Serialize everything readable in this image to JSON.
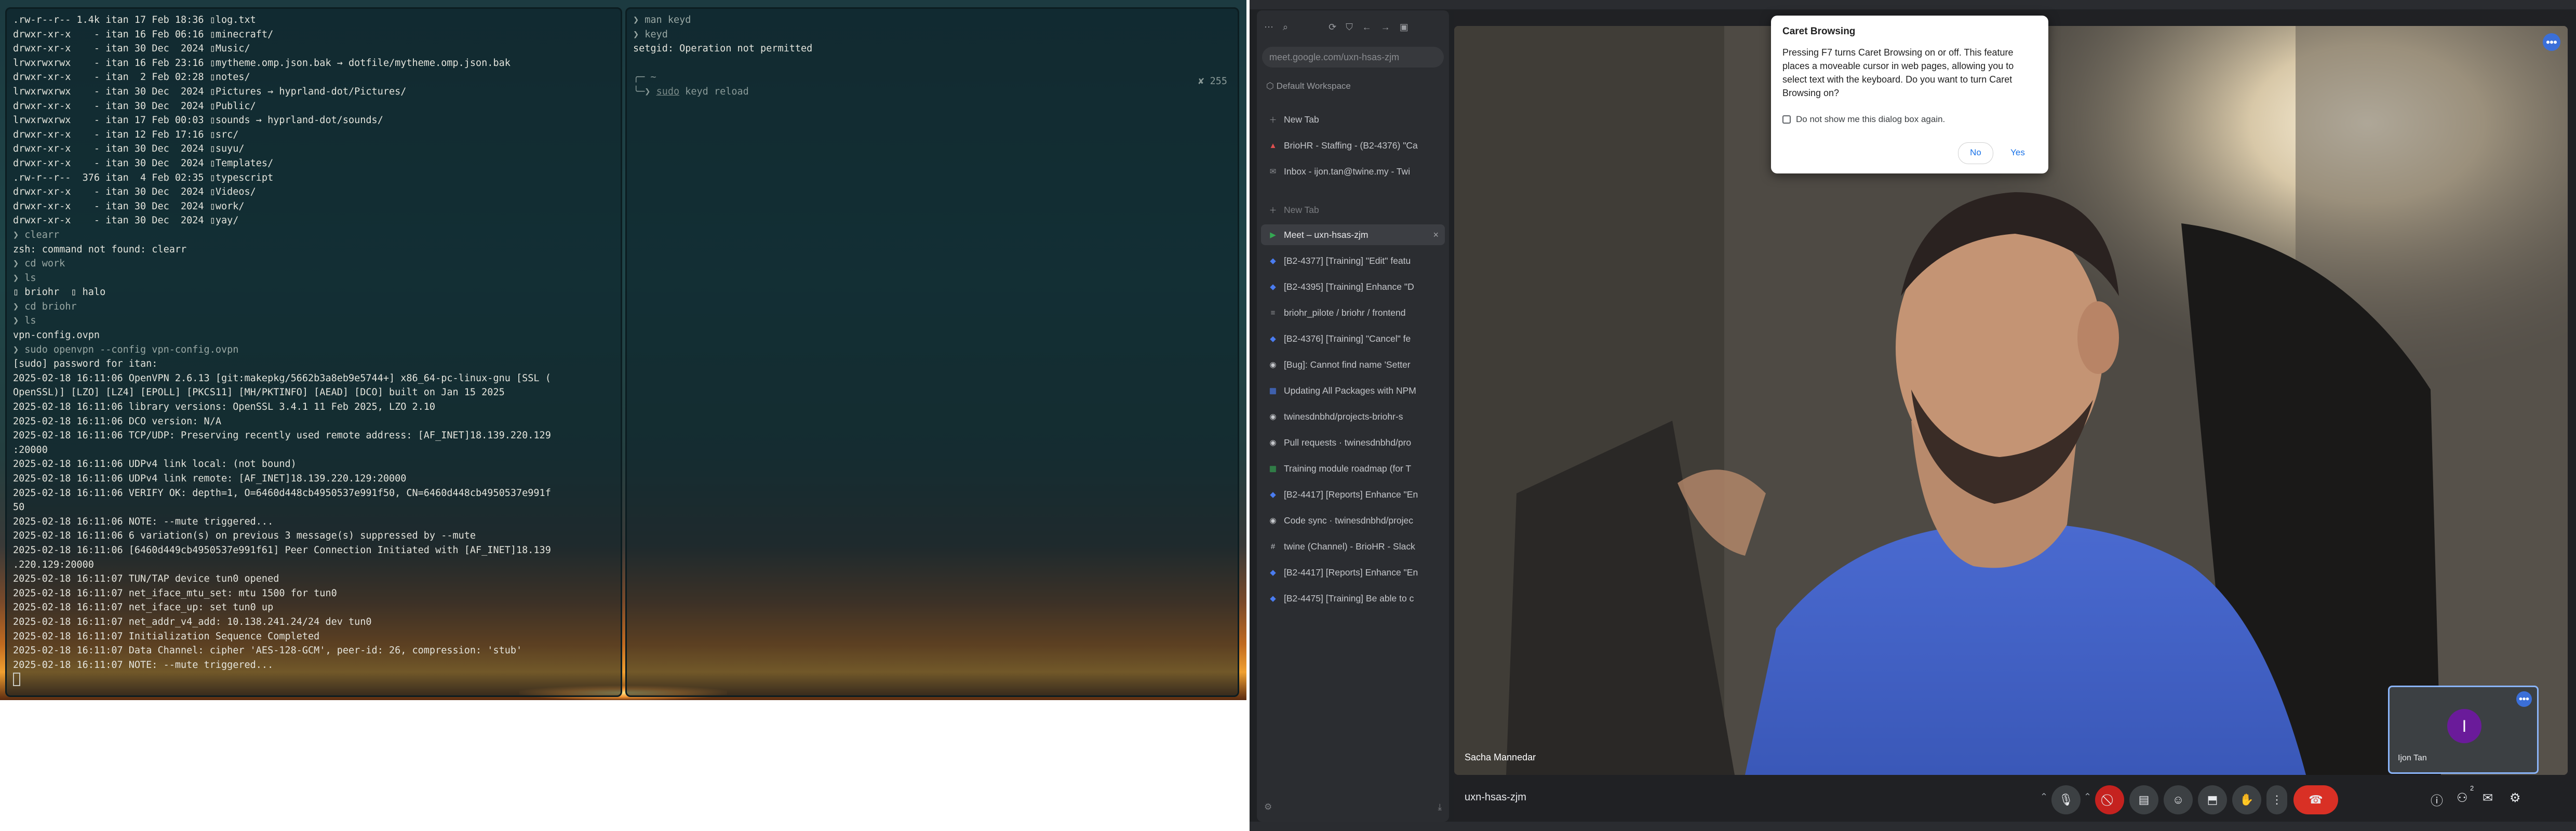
{
  "terminal_left": {
    "lines": [
      ".rw-r--r-- 1.4k itan 17 Feb 18:36 ▯log.txt",
      "drwxr-xr-x    - itan 16 Feb 06:16 ▯minecraft/",
      "drwxr-xr-x    - itan 30 Dec  2024 ▯Music/",
      "lrwxrwxrwx    - itan 16 Feb 23:16 ▯mytheme.omp.json.bak → dotfile/mytheme.omp.json.bak",
      "drwxr-xr-x    - itan  2 Feb 02:28 ▯notes/",
      "lrwxrwxrwx    - itan 30 Dec  2024 ▯Pictures → hyprland-dot/Pictures/",
      "drwxr-xr-x    - itan 30 Dec  2024 ▯Public/",
      "lrwxrwxrwx    - itan 17 Feb 00:03 ▯sounds → hyprland-dot/sounds/",
      "drwxr-xr-x    - itan 12 Feb 17:16 ▯src/",
      "drwxr-xr-x    - itan 30 Dec  2024 ▯suyu/",
      "drwxr-xr-x    - itan 30 Dec  2024 ▯Templates/",
      ".rw-r--r--  376 itan  4 Feb 02:35 ▯typescript",
      "drwxr-xr-x    - itan 30 Dec  2024 ▯Videos/",
      "drwxr-xr-x    - itan 30 Dec  2024 ▯work/",
      "drwxr-xr-x    - itan 30 Dec  2024 ▯yay/",
      "❯ clearr",
      "zsh: command not found: clearr",
      "❯ cd work",
      "❯ ls",
      "▯ briohr  ▯ halo",
      "❯ cd briohr",
      "❯ ls",
      "vpn-config.ovpn",
      "❯ sudo openvpn --config vpn-config.ovpn",
      "[sudo] password for itan:",
      "2025-02-18 16:11:06 OpenVPN 2.6.13 [git:makepkg/5662b3a8eb9e5744+] x86_64-pc-linux-gnu [SSL (",
      "OpenSSL)] [LZO] [LZ4] [EPOLL] [PKCS11] [MH/PKTINFO] [AEAD] [DCO] built on Jan 15 2025",
      "2025-02-18 16:11:06 library versions: OpenSSL 3.4.1 11 Feb 2025, LZO 2.10",
      "2025-02-18 16:11:06 DCO version: N/A",
      "2025-02-18 16:11:06 TCP/UDP: Preserving recently used remote address: [AF_INET]18.139.220.129",
      ":20000",
      "2025-02-18 16:11:06 UDPv4 link local: (not bound)",
      "2025-02-18 16:11:06 UDPv4 link remote: [AF_INET]18.139.220.129:20000",
      "2025-02-18 16:11:06 VERIFY OK: depth=1, O=6460d448cb4950537e991f50, CN=6460d448cb4950537e991f",
      "50",
      "2025-02-18 16:11:06 NOTE: --mute triggered...",
      "2025-02-18 16:11:06 6 variation(s) on previous 3 message(s) suppressed by --mute",
      "2025-02-18 16:11:06 [6460d449cb4950537e991f61] Peer Connection Initiated with [AF_INET]18.139",
      ".220.129:20000",
      "2025-02-18 16:11:07 TUN/TAP device tun0 opened",
      "2025-02-18 16:11:07 net_iface_mtu_set: mtu 1500 for tun0",
      "2025-02-18 16:11:07 net_iface_up: set tun0 up",
      "2025-02-18 16:11:07 net_addr_v4_add: 10.138.241.24/24 dev tun0",
      "2025-02-18 16:11:07 Initialization Sequence Completed",
      "2025-02-18 16:11:07 Data Channel: cipher 'AES-128-GCM', peer-id: 26, compression: 'stub'",
      "2025-02-18 16:11:07 NOTE: --mute triggered..."
    ]
  },
  "terminal_right": {
    "line1": "❯ man keyd",
    "line2": "❯ keyd",
    "line3": "setgid: Operation not permitted",
    "prompt_top": "╭─ ~",
    "prompt_bottom": "╰─❯ ",
    "cmd_sudo": "sudo",
    "cmd_rest": " keyd reload",
    "exit_code": "✘ 255"
  },
  "browser": {
    "url": "meet.google.com/uxn-hsas-zjm",
    "workspace_label": "Default Workspace",
    "new_tab_label": "New Tab",
    "pinned_tabs": [
      {
        "icon": "briohr-icon",
        "label": "BrioHR - Staffing - (B2-4376) \"Ca"
      },
      {
        "icon": "mail-icon",
        "label": "Inbox - ijon.tan@twine.my - Twi"
      }
    ],
    "new_tab_label_2": "New Tab",
    "tabs": [
      {
        "icon": "meet-icon",
        "label": "Meet – uxn-hsas-zjm",
        "active": true
      },
      {
        "icon": "jira-icon",
        "label": "[B2-4377] [Training] \"Edit\" featu",
        "active": false
      },
      {
        "icon": "jira-icon",
        "label": "[B2-4395] [Training] Enhance \"D",
        "active": false
      },
      {
        "icon": "repo-icon",
        "label": "briohr_pilote / briohr / frontend",
        "active": false
      },
      {
        "icon": "jira-icon",
        "label": "[B2-4376] [Training] \"Cancel\" fe",
        "active": false
      },
      {
        "icon": "github-icon",
        "label": "[Bug]: Cannot find name 'Setter",
        "active": false
      },
      {
        "icon": "doc-icon",
        "label": "Updating All Packages with NPM",
        "active": false
      },
      {
        "icon": "github-icon",
        "label": "twinesdnbhd/projects-briohr-s",
        "active": false
      },
      {
        "icon": "github-icon",
        "label": "Pull requests · twinesdnbhd/pro",
        "active": false
      },
      {
        "icon": "sheet-icon",
        "label": "Training module roadmap (for T",
        "active": false
      },
      {
        "icon": "jira-icon",
        "label": "[B2-4417] [Reports] Enhance \"En",
        "active": false
      },
      {
        "icon": "github-icon",
        "label": "Code sync · twinesdnbhd/projec",
        "active": false
      },
      {
        "icon": "slack-icon",
        "label": "twine (Channel) - BrioHR - Slack",
        "active": false
      },
      {
        "icon": "jira-icon",
        "label": "[B2-4417] [Reports] Enhance \"En",
        "active": false
      },
      {
        "icon": "jira-icon",
        "label": "[B2-4475] [Training] Be able to c",
        "active": false
      }
    ]
  },
  "meet": {
    "speaker_name": "Sacha Mannedar",
    "self_name": "Ijon Tan",
    "self_initial": "I",
    "meeting_code": "uxn-hsas-zjm",
    "participants_count": "2"
  },
  "dialog": {
    "title": "Caret Browsing",
    "body": "Pressing F7 turns Caret Browsing on or off. This feature places a moveable cursor in web pages, allowing you to select text with the keyboard. Do you want to turn Caret Browsing on?",
    "checkbox_label": "Do not show me this dialog box again.",
    "no_label": "No",
    "yes_label": "Yes"
  },
  "colors": {
    "accent": "#8ab4f8",
    "end_call": "#d93025",
    "avatar": "#6a1b9a"
  }
}
